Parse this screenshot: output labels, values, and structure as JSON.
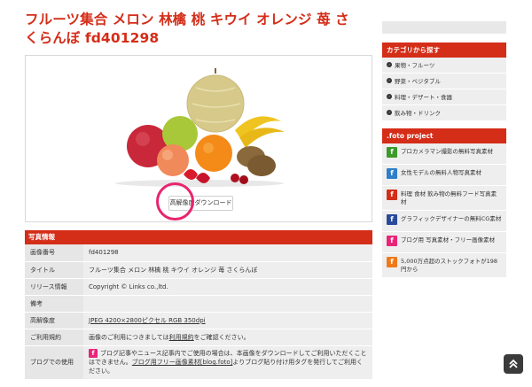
{
  "title": "フルーツ集合 メロン 林檎 桃 キウイ オレンジ 苺 さくらんぼ fd401298",
  "download_button": "高解像度ダウンロード",
  "info": {
    "header": "写真情報",
    "rows": [
      {
        "key": "画像番号",
        "value": "fd401298"
      },
      {
        "key": "タイトル",
        "value": "フルーツ集合 メロン 林檎 桃 キウイ オレンジ 苺 さくらんぼ"
      },
      {
        "key": "リリース情報",
        "value": "Copyright © Links co.,ltd."
      },
      {
        "key": "備考",
        "value": ""
      },
      {
        "key": "高解像度",
        "value": "JPEG 4200×2800ピクセル RGB 350dpi"
      },
      {
        "key": "ご利用規約",
        "value_prefix": "画像のご利用につきましては",
        "value_link": "利用規約",
        "value_suffix": "をご確認ください。"
      },
      {
        "key": "ブログでの使用",
        "value_prefix": "ブログ記事やニュース記事内でご使用の場合は、本画像をダウンロードしてご利用いただくことはできません。",
        "value_link": "ブログ用フリー画像素材[blog.foto]",
        "value_suffix": "よりブログ貼り付け用タグを発行してご利用ください。"
      }
    ]
  },
  "sidebar": {
    "categories_header": "カテゴリから探す",
    "categories": [
      "果物・フルーツ",
      "野菜・ベジタブル",
      "料理・デザート・食器",
      "飲み物・ドリンク"
    ],
    "project_header": ".foto project",
    "projects": [
      {
        "label": "プロカメラマン撮影の無料写真素材",
        "color": "#3a9a2a"
      },
      {
        "label": "女性モデルの無料人物写真素材",
        "color": "#2f7fc8"
      },
      {
        "label": "料理 食材 飲み物の無料フード写真素材",
        "color": "#d42d18"
      },
      {
        "label": "グラフィックデザイナーの無料CG素材",
        "color": "#2a4a9a"
      },
      {
        "label": "ブログ用 写真素材・フリー画像素材",
        "color": "#e8257a"
      },
      {
        "label": "5,000万点超のストックフォトが198円から",
        "color": "#f07a1a"
      }
    ]
  },
  "icons": {
    "project_glyph": "f",
    "blog_glyph": "f",
    "arrow": "›",
    "scroll_top": "double-chevron-up-icon"
  },
  "colors": {
    "accent": "#d42d18",
    "highlight": "#e8256e",
    "panel_bg": "#eeeeee"
  }
}
